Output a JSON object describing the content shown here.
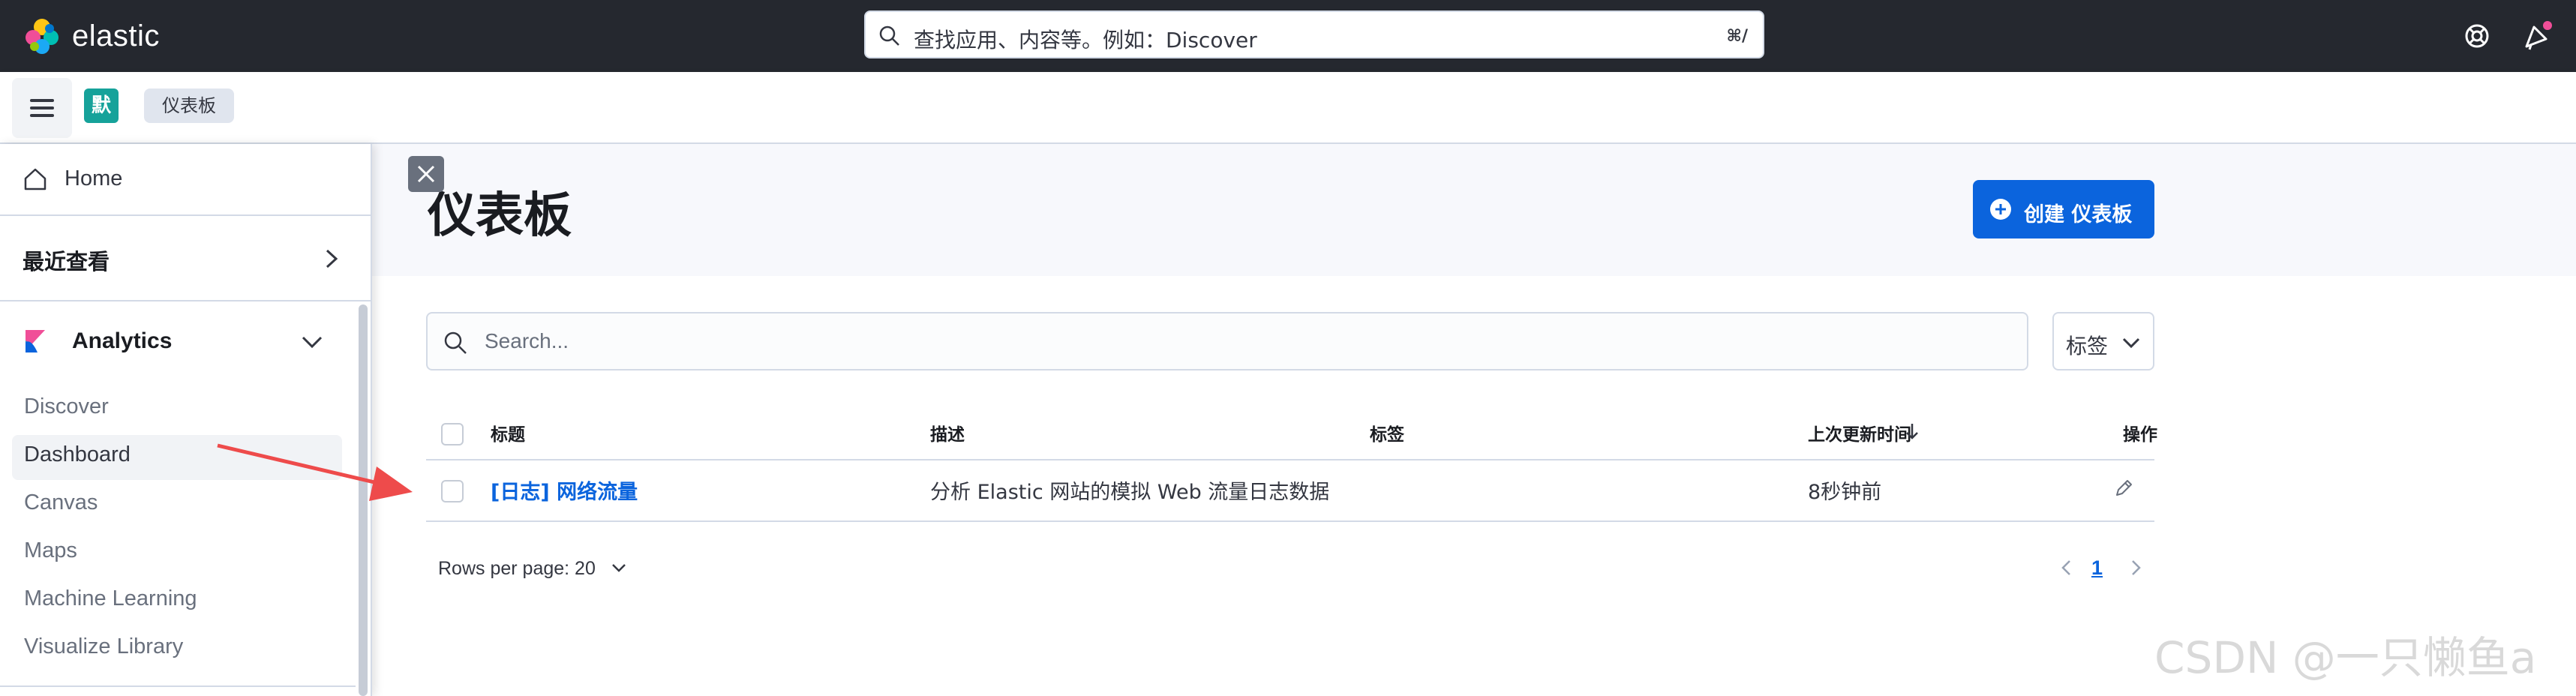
{
  "header": {
    "brand": "elastic",
    "search_placeholder": "查找应用、内容等。例如：Discover",
    "search_shortcut": "⌘/"
  },
  "subbar": {
    "space_initial": "默",
    "breadcrumb": "仪表板"
  },
  "sidebar": {
    "home": "Home",
    "recent": "最近查看",
    "section": "Analytics",
    "items": [
      {
        "label": "Discover"
      },
      {
        "label": "Dashboard"
      },
      {
        "label": "Canvas"
      },
      {
        "label": "Maps"
      },
      {
        "label": "Machine Learning"
      },
      {
        "label": "Visualize Library"
      }
    ]
  },
  "main": {
    "title": "仪表板",
    "create_button": "创建 仪表板",
    "search_placeholder": "Search...",
    "tags_filter": "标签",
    "columns": [
      "标题",
      "描述",
      "标签",
      "上次更新时间",
      "操作"
    ],
    "rows": [
      {
        "title": "[日志] 网络流量",
        "description": "分析 Elastic 网站的模拟 Web 流量日志数据",
        "tags": "",
        "updated": "8秒钟前"
      }
    ],
    "rows_per_page": "Rows per page: 20",
    "current_page": "1"
  },
  "watermark": "CSDN @一只懒鱼a",
  "colors": {
    "header_bg": "#25282f",
    "primary": "#0b64dd",
    "space_avatar": "#16a29a",
    "arrow": "#ee4b4b"
  },
  "icons": {
    "search": "search-icon",
    "help": "help-icon",
    "news": "newsfeed-icon",
    "menu": "hamburger-icon",
    "home": "home-icon",
    "chevron": "chevron-icon",
    "analytics": "kibana-logo-icon",
    "close": "close-icon",
    "plus": "plus-circle-icon",
    "edit": "pencil-icon",
    "sort": "sort-down-icon"
  }
}
